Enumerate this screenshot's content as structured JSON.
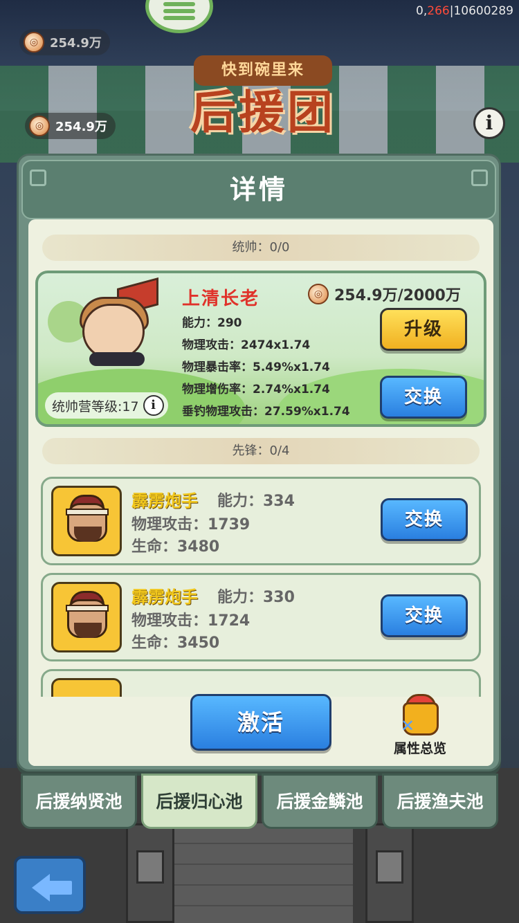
{
  "debug": {
    "prefix": "0,",
    "highlight": "266",
    "suffix": "|10600289"
  },
  "currency": {
    "amount_top": "254.9万",
    "amount": "254.9万"
  },
  "banner": {
    "subtitle": "快到碗里来",
    "title": "后援团"
  },
  "modal": {
    "title": "详情",
    "commander_section": "统帅：0/0",
    "vanguard_section": "先锋：0/4"
  },
  "commander": {
    "name": "上清长老",
    "cost": "254.9万/2000万",
    "stats": [
      "能力：290",
      "物理攻击：2474x1.74",
      "物理暴击率：5.49%x1.74",
      "物理增伤率：2.74%x1.74",
      "垂钓物理攻击：27.59%x1.74"
    ],
    "level_label": "统帅营等级:17",
    "upgrade_label": "升级",
    "swap_label": "交换"
  },
  "vanguards": [
    {
      "name": "霹雳炮手",
      "ability": "能力：334",
      "attack": "物理攻击：1739",
      "hp": "生命：3480",
      "swap_label": "交换"
    },
    {
      "name": "霹雳炮手",
      "ability": "能力：330",
      "attack": "物理攻击：1724",
      "hp": "生命：3450",
      "swap_label": "交换"
    }
  ],
  "actions": {
    "activate": "激活",
    "overview": "属性总览"
  },
  "tabs": [
    {
      "label": "后援纳贤池",
      "active": false
    },
    {
      "label": "后援归心池",
      "active": true
    },
    {
      "label": "后援金鳞池",
      "active": false
    },
    {
      "label": "后援渔夫池",
      "active": false
    }
  ],
  "icons": [
    "menu-icon",
    "coin-icon",
    "info-icon",
    "back-arrow-icon",
    "gift-bag-icon"
  ],
  "colors": {
    "accent_green": "#6fb15a",
    "name_red": "#e0322a",
    "name_gold": "#f2c81c",
    "button_blue": "#2a7fe0",
    "button_yellow": "#f0b020"
  }
}
